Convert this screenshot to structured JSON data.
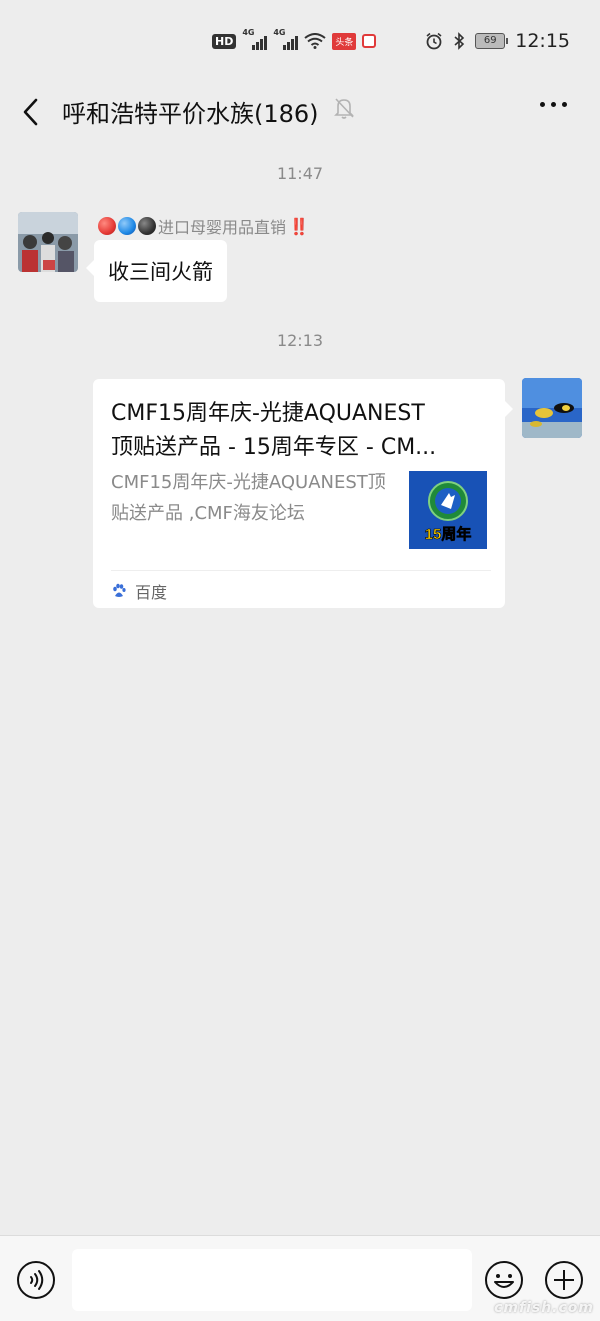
{
  "status_bar": {
    "hd_label": "HD",
    "sim1_net": "4G",
    "sim2_net": "4G",
    "toutiao_label": "头条",
    "battery_level": "69",
    "time": "12:15"
  },
  "header": {
    "title": "呼和浩特平价水族(186)",
    "icons": [
      "back-arrow-icon",
      "mute-bell-icon",
      "more-icon"
    ]
  },
  "messages": [
    {
      "type": "timestamp",
      "text": "11:47"
    },
    {
      "type": "text",
      "direction": "incoming",
      "sender_name": "进口母婴用品直销",
      "sender_emoji_colors": [
        "#e53935",
        "#1e88e5",
        "#333333"
      ],
      "sender_suffix": "‼️",
      "text": "收三间火箭"
    },
    {
      "type": "timestamp",
      "text": "12:13"
    },
    {
      "type": "link_card",
      "direction": "outgoing",
      "title_line1": "CMF15周年庆-光捷AQUANEST",
      "title_line2": "顶贴送产品 - 15周年专区 - CM...",
      "description": "CMF15周年庆-光捷AQUANEST顶贴送产品 ,CMF海友论坛",
      "thumbnail_label": "15周年",
      "source": "百度"
    }
  ],
  "input_bar": {
    "placeholder": "",
    "icons": [
      "voice-icon",
      "emoji-icon",
      "plus-icon"
    ]
  },
  "watermark": "cmfish.com"
}
